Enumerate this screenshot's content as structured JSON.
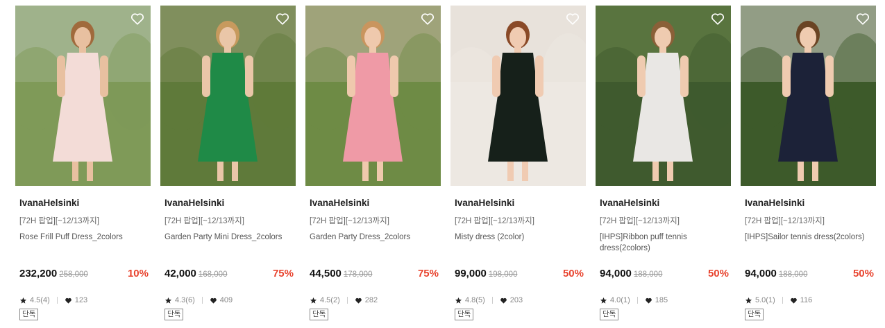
{
  "products": [
    {
      "brand": "IvanaHelsinki",
      "promo": "[72H 팝업][~12/13까지]",
      "name": "Rose Frill Puff Dress_2colors",
      "price": "232,200",
      "original_price": "258,000",
      "discount": "10%",
      "rating": "4.5(4)",
      "likes": "123",
      "tag": "단독",
      "colors": {
        "bg": "#7f9a58",
        "bg2": "#b9c7b6",
        "dress": "#f3dcd7",
        "skin": "#e8c0a0",
        "hair": "#a06a3c"
      }
    },
    {
      "brand": "IvanaHelsinki",
      "promo": "[72H 팝업][~12/13까지]",
      "name": "Garden Party Mini Dress_2colors",
      "price": "42,000",
      "original_price": "168,000",
      "discount": "75%",
      "rating": "4.3(6)",
      "likes": "409",
      "tag": "단독",
      "colors": {
        "bg": "#5f7a3a",
        "bg2": "#9aa07a",
        "dress": "#1f8a47",
        "skin": "#eac6a8",
        "hair": "#c79a5e"
      }
    },
    {
      "brand": "IvanaHelsinki",
      "promo": "[72H 팝업][~12/13까지]",
      "name": "Garden Party Dress_2colors",
      "price": "44,500",
      "original_price": "178,000",
      "discount": "75%",
      "rating": "4.5(2)",
      "likes": "282",
      "tag": "단독",
      "colors": {
        "bg": "#6e8b45",
        "bg2": "#c9b8a6",
        "dress": "#ef9aa6",
        "skin": "#efc9ad",
        "hair": "#c9955e"
      }
    },
    {
      "brand": "IvanaHelsinki",
      "promo": "[72H 팝업][~12/13까지]",
      "name": "Misty dress (2color)",
      "price": "99,000",
      "original_price": "198,000",
      "discount": "50%",
      "rating": "4.8(5)",
      "likes": "203",
      "tag": "단독",
      "colors": {
        "bg": "#ede8e2",
        "bg2": "#e3ddd6",
        "dress": "#16201a",
        "skin": "#f0cbb2",
        "hair": "#8a4a28"
      }
    },
    {
      "brand": "IvanaHelsinki",
      "promo": "[72H 팝업][~12/13까지]",
      "name": "[IHPS]Ribbon puff tennis dress(2colors)",
      "price": "94,000",
      "original_price": "188,000",
      "discount": "50%",
      "rating": "4.0(1)",
      "likes": "185",
      "tag": "단독",
      "colors": {
        "bg": "#3f5a2e",
        "bg2": "#6f8b4e",
        "dress": "#e9e7e4",
        "skin": "#efcbb0",
        "hair": "#8a6038"
      }
    },
    {
      "brand": "IvanaHelsinki",
      "promo": "[72H 팝업][~12/13까지]",
      "name": "[IHPS]Sailor tennis dress(2colors)",
      "price": "94,000",
      "original_price": "188,000",
      "discount": "50%",
      "rating": "5.0(1)",
      "likes": "116",
      "tag": "단독",
      "colors": {
        "bg": "#3d5a2a",
        "bg2": "#d8d6d0",
        "dress": "#1c2238",
        "skin": "#efcbb0",
        "hair": "#6a4424"
      }
    }
  ],
  "icons": {
    "wishlist": "heart-outline-icon",
    "rating": "star-icon",
    "likes": "heart-filled-icon"
  }
}
